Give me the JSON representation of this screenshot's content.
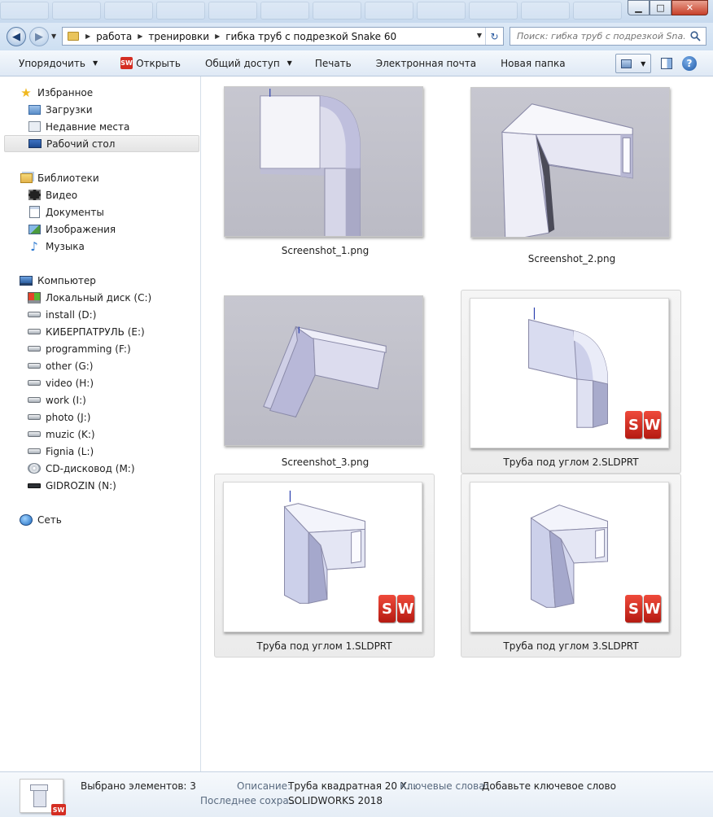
{
  "window": {
    "controls": {
      "minimize": "▁",
      "maximize": "□",
      "close": "✕"
    }
  },
  "address": {
    "crumbs": [
      "работа",
      "тренировки",
      "гибка труб с подрезкой Snake 60"
    ],
    "search_placeholder": "Поиск: гибка труб с подрезкой Sna...",
    "icons": {
      "back": "◀",
      "forward": "▶",
      "dropdown": "▼",
      "refresh": "↻",
      "separator": "▶"
    }
  },
  "toolbar": {
    "organize": "Упорядочить",
    "open": "Открыть",
    "open_badge": "SW",
    "share": "Общий доступ",
    "print": "Печать",
    "email": "Электронная почта",
    "new_folder": "Новая папка",
    "help": "?",
    "dropdown_glyph": "▼"
  },
  "nav": {
    "favorites": {
      "label": "Избранное",
      "items": [
        "Загрузки",
        "Недавние места",
        "Рабочий стол"
      ]
    },
    "libraries": {
      "label": "Библиотеки",
      "items": [
        "Видео",
        "Документы",
        "Изображения",
        "Музыка"
      ]
    },
    "computer": {
      "label": "Компьютер",
      "items": [
        "Локальный диск (C:)",
        "install (D:)",
        "КИБЕРПАТРУЛЬ (E:)",
        "programming (F:)",
        "other (G:)",
        "video (H:)",
        "work (I:)",
        "photo (J:)",
        "muzic (K:)",
        "Fignia (L:)",
        "CD-дисковод (M:)",
        "GIDROZIN (N:)"
      ]
    },
    "network": {
      "label": "Сеть"
    },
    "glyphs": {
      "star": "★",
      "music": "♪"
    }
  },
  "files": [
    {
      "name": "Screenshot_1.png",
      "kind": "png",
      "selected": false
    },
    {
      "name": "Screenshot_2.png",
      "kind": "png",
      "selected": false
    },
    {
      "name": "Screenshot_3.png",
      "kind": "png",
      "selected": false
    },
    {
      "name": "Труба под углом 2.SLDPRT",
      "kind": "sldprt",
      "selected": true
    },
    {
      "name": "Труба под углом 1.SLDPRT",
      "kind": "sldprt",
      "selected": true
    },
    {
      "name": "Труба под углом 3.SLDPRT",
      "kind": "sldprt",
      "selected": true
    }
  ],
  "sw_badge": {
    "s": "S",
    "w": "W"
  },
  "details": {
    "selected_count": "Выбрано элементов: 3",
    "description_key": "Описание:",
    "description_value": "Труба квадратная  20 Х...",
    "keywords_key": "Ключевые слова:",
    "keywords_value": "Добавьте ключевое слово",
    "last_saved_key": "Последнее сохра...",
    "last_saved_value": "SOLIDWORKS 2018",
    "thumb_badge": "SW"
  },
  "colors": {
    "accent": "#1d57a5",
    "solidworks_red": "#d42d22",
    "thumb_gray": "#c3c3cc"
  }
}
